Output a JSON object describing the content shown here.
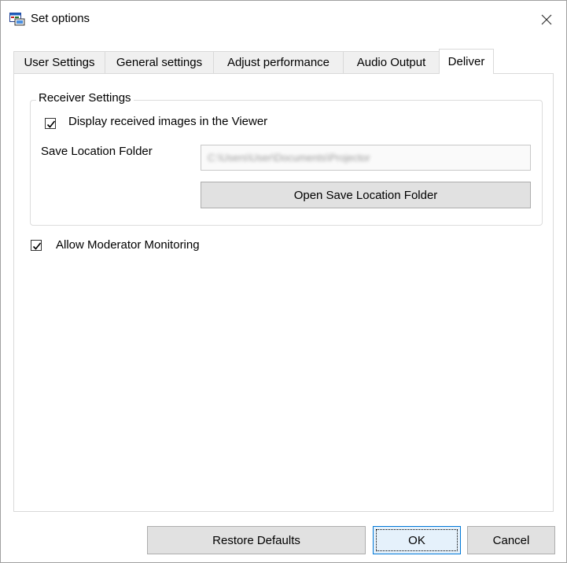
{
  "window": {
    "title": "Set options",
    "close_glyph": "✕"
  },
  "tabs": [
    {
      "label": "User Settings",
      "active": false
    },
    {
      "label": "General settings",
      "active": false
    },
    {
      "label": "Adjust performance",
      "active": false
    },
    {
      "label": "Audio Output",
      "active": false
    },
    {
      "label": "Deliver",
      "active": true
    }
  ],
  "receiver_settings": {
    "group_label": "Receiver Settings",
    "display_received_images": {
      "label": "Display received images in the Viewer",
      "checked": true
    },
    "save_location_label": "Save Location Folder",
    "save_location_value": "C:\\Users\\User\\Documents\\Projector",
    "open_folder_button": "Open Save Location Folder"
  },
  "allow_moderator_monitoring": {
    "label": "Allow Moderator Monitoring",
    "checked": true
  },
  "footer": {
    "restore_defaults": "Restore Defaults",
    "ok": "OK",
    "cancel": "Cancel"
  },
  "icons": {
    "app": "app-window-icon",
    "close": "close-icon",
    "check": "checkmark-icon"
  },
  "colors": {
    "ok_border": "#0078d7",
    "ok_fill": "#e5f1fb",
    "button_fill": "#e1e1e1"
  }
}
